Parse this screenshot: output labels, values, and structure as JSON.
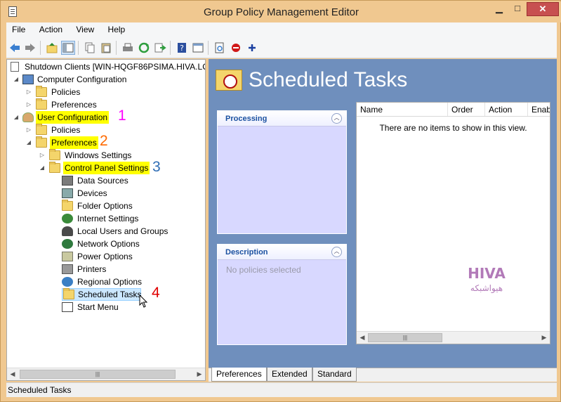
{
  "window": {
    "title": "Group Policy Management Editor"
  },
  "menu": [
    "File",
    "Action",
    "View",
    "Help"
  ],
  "tree": {
    "root": "Shutdown Clients [WIN-HQGF86PSIMA.HIVA.LO",
    "nodes": [
      {
        "label": "Computer Configuration"
      },
      {
        "label": "Policies"
      },
      {
        "label": "Preferences"
      },
      {
        "label": "User Configuration"
      },
      {
        "label": "Policies"
      },
      {
        "label": "Preferences"
      },
      {
        "label": "Windows Settings"
      },
      {
        "label": "Control Panel Settings"
      },
      {
        "label": "Data Sources"
      },
      {
        "label": "Devices"
      },
      {
        "label": "Folder Options"
      },
      {
        "label": "Internet Settings"
      },
      {
        "label": "Local Users and Groups"
      },
      {
        "label": "Network Options"
      },
      {
        "label": "Power Options"
      },
      {
        "label": "Printers"
      },
      {
        "label": "Regional Options"
      },
      {
        "label": "Scheduled Tasks"
      },
      {
        "label": "Start Menu"
      }
    ]
  },
  "annotations": {
    "a1": "1",
    "a2": "2",
    "a3": "3",
    "a4": "4"
  },
  "annotation_colors": {
    "a1": "#ff00ff",
    "a2": "#ff6a00",
    "a3": "#2f6db5",
    "a4": "#e00000"
  },
  "content": {
    "title": "Scheduled Tasks",
    "processing_panel": {
      "title": "Processing"
    },
    "description_panel": {
      "title": "Description",
      "text": "No policies selected"
    },
    "columns": [
      "Name",
      "Order",
      "Action",
      "Enab"
    ],
    "empty_message": "There are no items to show in this view."
  },
  "bottom_tabs": [
    "Preferences",
    "Extended",
    "Standard"
  ],
  "status": "Scheduled Tasks",
  "watermark": {
    "brand": "HIVA",
    "tagline": "هیواشبکه"
  },
  "colors": {
    "highlight": "#ffff00",
    "right_pane_bg": "#6f8fbd",
    "selection": "#cce8ff"
  }
}
